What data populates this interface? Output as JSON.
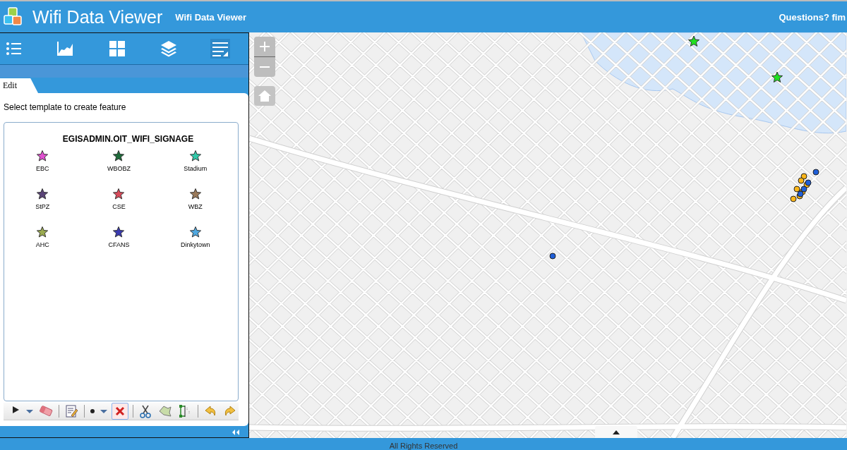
{
  "header": {
    "title": "Wifi Data Viewer",
    "subtitle": "Wifi Data Viewer",
    "contact": "Questions? fim"
  },
  "panel_tabs": [
    {
      "kind": "legend",
      "selected": false
    },
    {
      "kind": "chart",
      "selected": false
    },
    {
      "kind": "grid",
      "selected": false
    },
    {
      "kind": "layers",
      "selected": false
    },
    {
      "kind": "edit",
      "selected": true
    }
  ],
  "edit_tab": {
    "label": "Edit",
    "selected": true
  },
  "instruction": "Select template to create feature",
  "template_group": {
    "title": "EGISADMIN.OIT_WIFI_SIGNAGE",
    "templates": [
      {
        "label": "EBC",
        "color": "#e050d0"
      },
      {
        "label": "WBOBZ",
        "color": "#1e6b3a"
      },
      {
        "label": "Stadium",
        "color": "#30c8a8"
      },
      {
        "label": "StPZ",
        "color": "#5a4478"
      },
      {
        "label": "CSE",
        "color": "#d84a5a"
      },
      {
        "label": "WBZ",
        "color": "#9a7a5a"
      },
      {
        "label": "AHC",
        "color": "#9aaa50"
      },
      {
        "label": "CFANS",
        "color": "#3a3ab0"
      },
      {
        "label": "Dinkytown",
        "color": "#50a8e0"
      }
    ]
  },
  "edit_tools": [
    {
      "kind": "pointer",
      "selected": false
    },
    {
      "kind": "dropdown",
      "selected": false
    },
    {
      "kind": "eraser",
      "selected": false
    },
    {
      "kind": "sep"
    },
    {
      "kind": "attributes",
      "selected": false
    },
    {
      "kind": "sep"
    },
    {
      "kind": "dot",
      "selected": false
    },
    {
      "kind": "dropdown",
      "selected": false
    },
    {
      "kind": "delete",
      "selected": true
    },
    {
      "kind": "sep"
    },
    {
      "kind": "cut",
      "selected": false
    },
    {
      "kind": "reshape",
      "selected": false
    },
    {
      "kind": "split",
      "selected": false
    },
    {
      "kind": "sep"
    },
    {
      "kind": "undo",
      "selected": false
    },
    {
      "kind": "redo",
      "selected": false
    }
  ],
  "footer": {
    "text": "All Rights Reserved"
  }
}
